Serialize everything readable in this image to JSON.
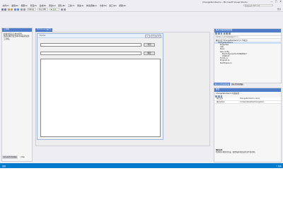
{
  "window": {
    "title": "ChangeSkinDemo - Microsoft Visual Studio",
    "buttons": [
      "—",
      "□",
      "✕"
    ]
  },
  "menu": [
    "文件(F)",
    "编辑(E)",
    "视图(V)",
    "项目(P)",
    "生成(B)",
    "调试(D)",
    "团队(M)",
    "工具(T)",
    "测试(S)",
    "体系结构(C)",
    "分析(N)",
    "窗口(W)",
    "帮助(H)"
  ],
  "quick_launch": {
    "placeholder": "快速启动 (Ctrl+Q)"
  },
  "toolbar": {
    "config": "Debug",
    "platform": "Any CPU",
    "start_label": "▶ 启动",
    "login": "登录"
  },
  "toolbox": {
    "title": "工具箱",
    "lines": [
      "此组中没有可用的控件。",
      "将某项拖至此文本可将其添加到工具箱。"
    ],
    "bottom_tabs": [
      "服务器资源管理器",
      "工具箱"
    ]
  },
  "designer": {
    "tab": "Form1.cs [设计]",
    "form_title": "Form1",
    "button1": "浏览",
    "button2": "确定"
  },
  "solution_explorer": {
    "title": "解决方案资源管理器",
    "search_placeholder": "搜索解决方案资源管理器(Ctrl+;)",
    "nodes": [
      {
        "text": "解决方案“ChangeSkinDemo”(1 个项目)",
        "indent": 0,
        "selected": false
      },
      {
        "text": "ChangeSkinDemo",
        "indent": 1,
        "selected": true
      },
      {
        "text": "Properties",
        "indent": 2,
        "selected": false
      },
      {
        "text": "引用",
        "indent": 2,
        "selected": false
      },
      {
        "text": "Skins",
        "indent": 2,
        "selected": false
      },
      {
        "text": "App.config",
        "indent": 2,
        "selected": false
      },
      {
        "text": "DevComponents.DotNetBar2",
        "indent": 3,
        "selected": false
      },
      {
        "text": "IrisSkin4",
        "indent": 3,
        "selected": false
      },
      {
        "text": "Form1.cs",
        "indent": 2,
        "selected": false
      },
      {
        "text": "Program.cs",
        "indent": 2,
        "selected": false
      },
      {
        "text": "SkinEngine.cs",
        "indent": 2,
        "selected": false
      }
    ],
    "tabs": [
      "解决方案资源管理器",
      "团队资源管理器"
    ]
  },
  "properties": {
    "title": "属性",
    "object": "ChangeSkinDemo 项目属性",
    "rows": [
      {
        "key": "项目文件",
        "value": "ChangeSkinDemo.csproj"
      },
      {
        "key": "项目文件夹",
        "value": "C:\\Users\\Desktop\\ChangeSkin"
      }
    ],
    "desc_title": "项目文件",
    "desc_text": "包含有关项目的生成、配置和其他信息的文件的名称。"
  },
  "status": {
    "left": "就绪",
    "right": "↑ 发布"
  },
  "colors": {
    "accent": "#007acc",
    "panel_header": "#4e7cc9",
    "ide_bg": "#eeeef2"
  }
}
